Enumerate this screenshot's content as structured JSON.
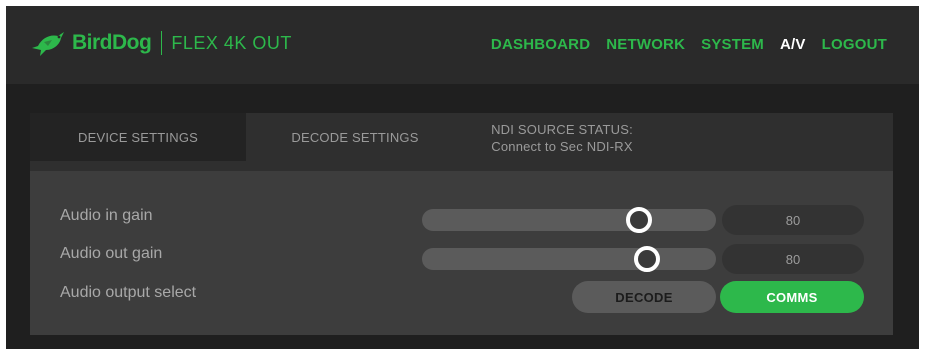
{
  "header": {
    "brand": "BirdDog",
    "product": "FLEX 4K OUT",
    "logo_icon": "bird-icon",
    "accent_color": "#2db84b"
  },
  "nav": [
    {
      "label": "DASHBOARD",
      "active": false
    },
    {
      "label": "NETWORK",
      "active": false
    },
    {
      "label": "SYSTEM",
      "active": false
    },
    {
      "label": "A/V",
      "active": true
    },
    {
      "label": "LOGOUT",
      "active": false
    }
  ],
  "tabs": {
    "device": "DEVICE SETTINGS",
    "decode": "DECODE SETTINGS",
    "status_title": "NDI SOURCE STATUS:",
    "status_value": "Connect to Sec NDI-RX"
  },
  "settings": {
    "audio_in_gain": {
      "label": "Audio in gain",
      "value": "80",
      "level_fraction": 0.8
    },
    "audio_out_gain": {
      "label": "Audio out gain",
      "value": "80",
      "level_fraction": 0.8
    },
    "audio_output_select": {
      "label": "Audio output select",
      "options": [
        "DECODE",
        "COMMS"
      ],
      "selected": "COMMS"
    }
  }
}
